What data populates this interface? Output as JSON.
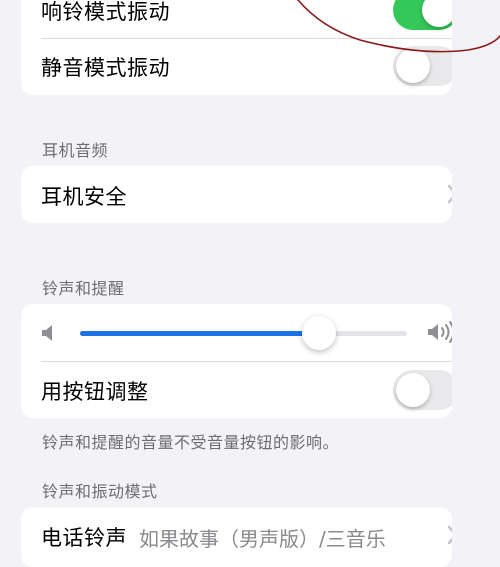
{
  "vibration": {
    "ring_vibrate_label": "响铃模式振动",
    "ring_vibrate_on": true,
    "silent_vibrate_label": "静音模式振动",
    "silent_vibrate_on": false
  },
  "headphone_audio": {
    "section_title": "耳机音频",
    "headphone_safety_label": "耳机安全"
  },
  "ringer": {
    "section_title": "铃声和提醒",
    "volume_level": 0.73,
    "change_with_buttons_label": "用按钮调整",
    "change_with_buttons_on": false,
    "footnote": "铃声和提醒的音量不受音量按钮的影响。"
  },
  "sounds_patterns": {
    "section_title": "铃声和振动模式",
    "ringtone_label": "电话铃声",
    "ringtone_value": "如果故事（男声版）/三音乐"
  },
  "colors": {
    "toggle_on": "#34c759",
    "toggle_off": "#e9e9eb",
    "slider_fill": "#1d72e8",
    "annotation": "#8b1a1a"
  }
}
